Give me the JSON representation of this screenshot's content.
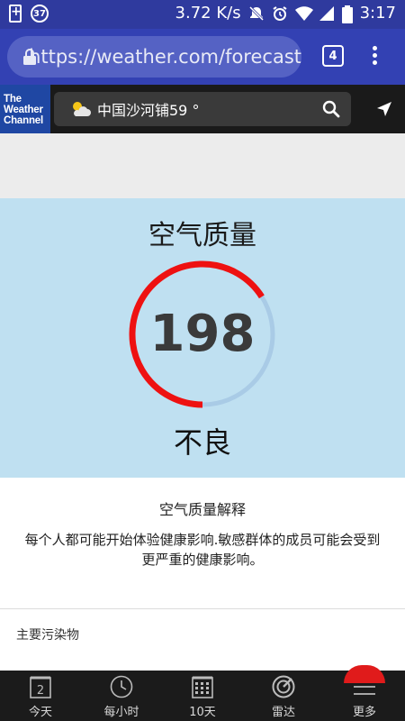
{
  "status_bar": {
    "notification_badge": "37",
    "net_speed": "3.72 K/s",
    "time": "3:17"
  },
  "browser": {
    "url": "https://weather.com/forecast",
    "tab_count": "4"
  },
  "twc": {
    "logo_lines": [
      "The",
      "Weather",
      "Channel"
    ],
    "location_text": "中国沙河铺59 °"
  },
  "air_quality": {
    "title": "空气质量",
    "value": "198",
    "level": "不良",
    "gauge_fraction": 0.66,
    "gauge_color": "#ee1111",
    "track_color": "#a9cbe6"
  },
  "explanation": {
    "title": "空气质量解释",
    "text": "每个人都可能开始体验健康影响.敏感群体的成员可能会受到更严重的健康影响。"
  },
  "pollutants": {
    "label": "主要污染物"
  },
  "bottom_nav": {
    "items": [
      {
        "label": "今天",
        "icon": "calendar-day-icon",
        "icon_text": "2"
      },
      {
        "label": "每小时",
        "icon": "clock-icon"
      },
      {
        "label": "10天",
        "icon": "calendar-grid-icon"
      },
      {
        "label": "雷达",
        "icon": "radar-icon"
      },
      {
        "label": "更多",
        "icon": "hamburger-menu-icon"
      }
    ]
  }
}
